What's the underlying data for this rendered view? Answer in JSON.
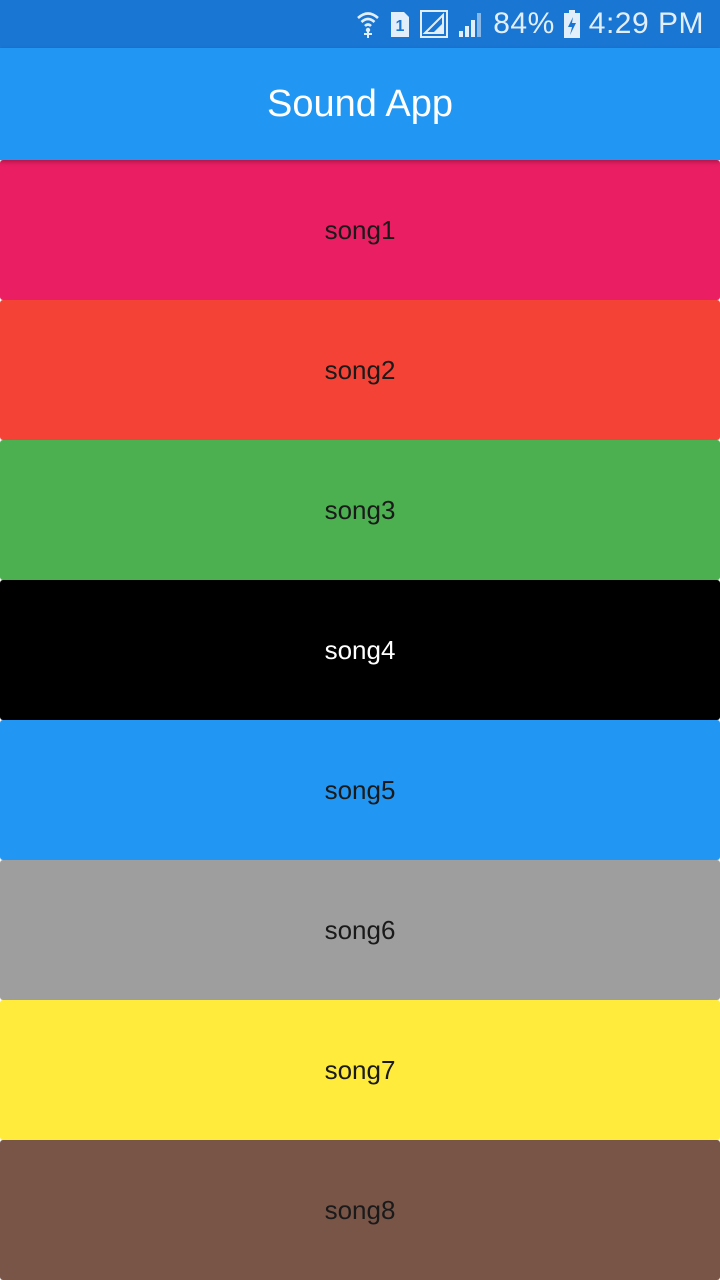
{
  "status_bar": {
    "battery_percent": "84%",
    "time": "4:29 PM",
    "sim_number": "1",
    "icons": [
      "wifi-calling-icon",
      "sim-icon",
      "signal-icon",
      "signal-icon",
      "battery-charging-icon"
    ]
  },
  "app_bar": {
    "title": "Sound App",
    "color": "#2196F3"
  },
  "songs": [
    {
      "label": "song1",
      "color": "#E91E63",
      "text_color": "#1a1a1a"
    },
    {
      "label": "song2",
      "color": "#F44336",
      "text_color": "#1a1a1a"
    },
    {
      "label": "song3",
      "color": "#4CAF50",
      "text_color": "#1a1a1a"
    },
    {
      "label": "song4",
      "color": "#000000",
      "text_color": "#ffffff"
    },
    {
      "label": "song5",
      "color": "#2196F3",
      "text_color": "#1a1a1a"
    },
    {
      "label": "song6",
      "color": "#9E9E9E",
      "text_color": "#1a1a1a"
    },
    {
      "label": "song7",
      "color": "#FFEB3B",
      "text_color": "#1a1a1a"
    },
    {
      "label": "song8",
      "color": "#795548",
      "text_color": "#1a1a1a"
    }
  ]
}
